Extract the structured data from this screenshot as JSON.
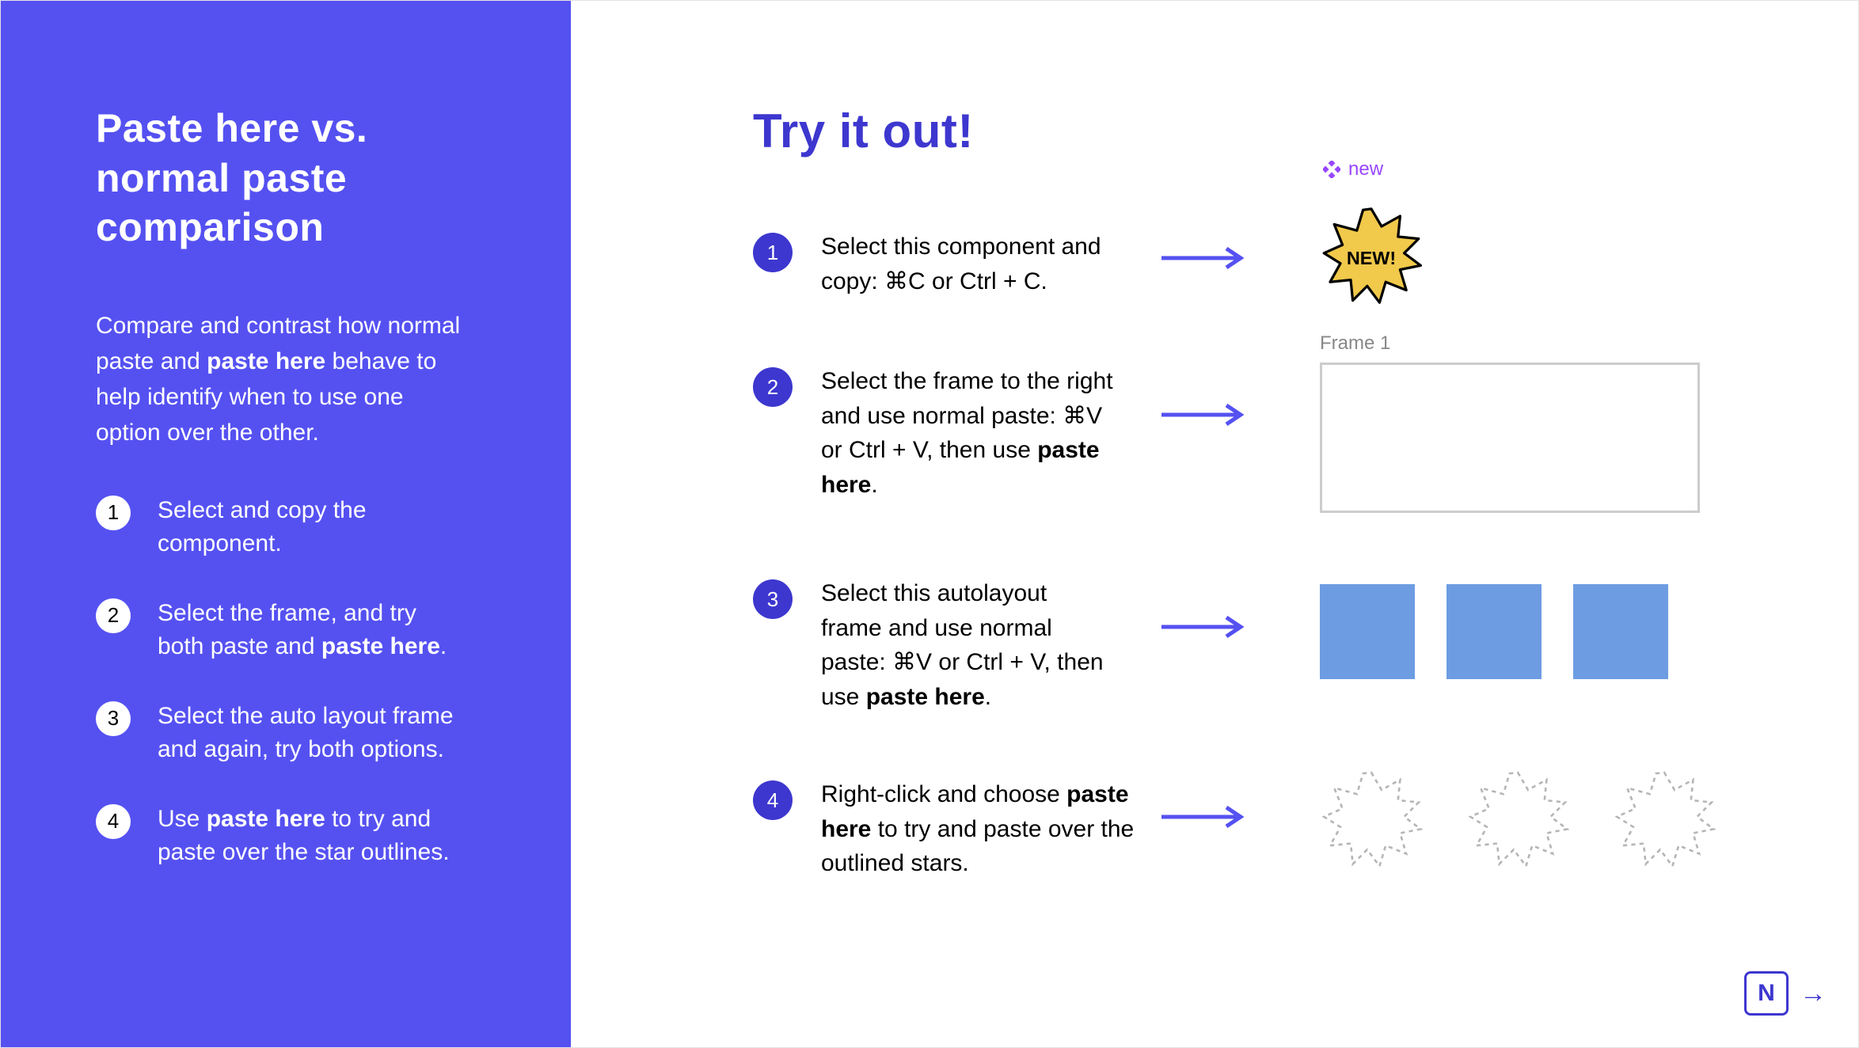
{
  "colors": {
    "accent": "#5551F1",
    "accent_dark": "#3D37CF",
    "component": "#9747FF",
    "square": "#6E9CE2"
  },
  "sidebar": {
    "title": "Paste here  vs. normal paste comparison",
    "intro_pre": "Compare and contrast how normal paste and ",
    "intro_bold": "paste here",
    "intro_post": " behave to help identify when to use one option over the other.",
    "items": [
      {
        "text_pre": "Select and copy the component.",
        "bold": "",
        "text_post": ""
      },
      {
        "text_pre": "Select the frame, and try both paste and ",
        "bold": "paste here",
        "text_post": "."
      },
      {
        "text_pre": "Select the auto layout frame and again, try both options.",
        "bold": "",
        "text_post": ""
      },
      {
        "text_pre": "Use ",
        "bold": "paste here",
        "text_post": " to try and paste over the star outlines."
      }
    ]
  },
  "main": {
    "heading": "Try it out!",
    "steps": [
      {
        "text_pre": "Select this component and copy: ⌘C or Ctrl + C.",
        "bold": "",
        "text_post": ""
      },
      {
        "text_pre": "Select the frame to the right and use normal paste: ⌘V or Ctrl + V, then use ",
        "bold": "paste here",
        "text_post": "."
      },
      {
        "text_pre": "Select this autolayout frame and use normal paste: ⌘V or Ctrl + V, then use ",
        "bold": "paste here",
        "text_post": "."
      },
      {
        "text_pre": "Right-click and choose ",
        "bold": "paste here",
        "text_post": " to try and paste over the outlined stars."
      }
    ],
    "component_label": "new",
    "badge_text": "NEW!",
    "frame_label": "Frame 1",
    "next_label": "N"
  }
}
